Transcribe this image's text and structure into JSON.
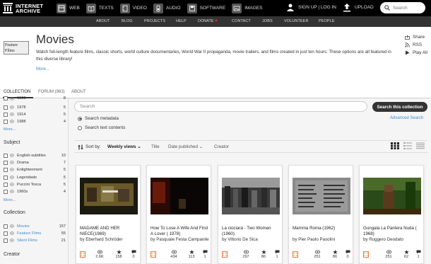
{
  "topbar": {
    "logo_line1": "INTERNET",
    "logo_line2": "ARCHIVE",
    "mediatypes": [
      "WEB",
      "TEXTS",
      "VIDEO",
      "AUDIO",
      "SOFTWARE",
      "IMAGES"
    ],
    "user_link": "SIGN UP | LOG IN",
    "upload": "UPLOAD",
    "search_placeholder": "Search"
  },
  "subnav": [
    "ABOUT",
    "BLOG",
    "PROJECTS",
    "HELP",
    "DONATE",
    "CONTACT",
    "JOBS",
    "VOLUNTEER",
    "PEOPLE"
  ],
  "collection": {
    "logo_text": "Feature Films",
    "title": "Movies",
    "description": "Watch full-length feature films, classic shorts, world culture documentaries, World War II propaganda, movie trailers, and films created in just ten hours: These options are all featured in this diverse library!",
    "more": "More...",
    "actions": [
      "Share",
      "RSS",
      "Play All"
    ]
  },
  "tabs": [
    "COLLECTION",
    "FORUM (963)",
    "ABOUT"
  ],
  "sidebar": {
    "year_items": [
      {
        "label": "1960",
        "count": "8"
      },
      {
        "label": "1978",
        "count": "5"
      },
      {
        "label": "1914",
        "count": "5"
      },
      {
        "label": "1988",
        "count": "4"
      }
    ],
    "more": "More...",
    "subject_heading": "Subject",
    "subject_items": [
      {
        "label": "English-subtitles",
        "count": "10"
      },
      {
        "label": "Drama",
        "count": "7"
      },
      {
        "label": "Enlightenment",
        "count": "5"
      },
      {
        "label": "Legendado",
        "count": "5"
      },
      {
        "label": "Puccini Tosca",
        "count": "5"
      },
      {
        "label": "1960s",
        "count": "4"
      }
    ],
    "collection_heading": "Collection",
    "collection_items": [
      {
        "label": "Movies",
        "count": "157"
      },
      {
        "label": "Feature Films",
        "count": "55"
      },
      {
        "label": "Silent Films",
        "count": "21"
      }
    ],
    "creator_heading": "Creator"
  },
  "search": {
    "placeholder": "Search",
    "button": "Search this collection",
    "option_metadata": "Search metadata",
    "option_text": "Search text contents",
    "advanced": "Advanced Search"
  },
  "sort": {
    "label": "Sort by:",
    "selected": "Weekly views",
    "options": [
      "Title",
      "Date published",
      "Creator"
    ]
  },
  "items": [
    {
      "title": "MADAME AND HER NIECE(1969)",
      "by": "by Eberhard Schröder",
      "views": "2.6K",
      "favs": "158",
      "reviews": "0"
    },
    {
      "title": "How To Lose A Wife And Find A Lover ( 1978)",
      "by": "by Pasquale Festa Campanile",
      "views": "434",
      "favs": "113",
      "reviews": "1"
    },
    {
      "title": "La ciociara - Two Women (1960)",
      "by": "by Vittorio De Sica",
      "views": "297",
      "favs": "86",
      "reviews": "1"
    },
    {
      "title": "Mamma Roma (1962)",
      "by": "by Pier Paolo Pasolini",
      "views": "251",
      "favs": "86",
      "reviews": "0"
    },
    {
      "title": "Gungala La Pantera Nuda ( 1968)",
      "by": "by Ruggero Deodato",
      "views": "251",
      "favs": "62",
      "reviews": "1"
    }
  ],
  "colors": {
    "topbar": "#000000",
    "subnav": "#333333",
    "link": "#428bca",
    "heart": "#ee3333"
  }
}
